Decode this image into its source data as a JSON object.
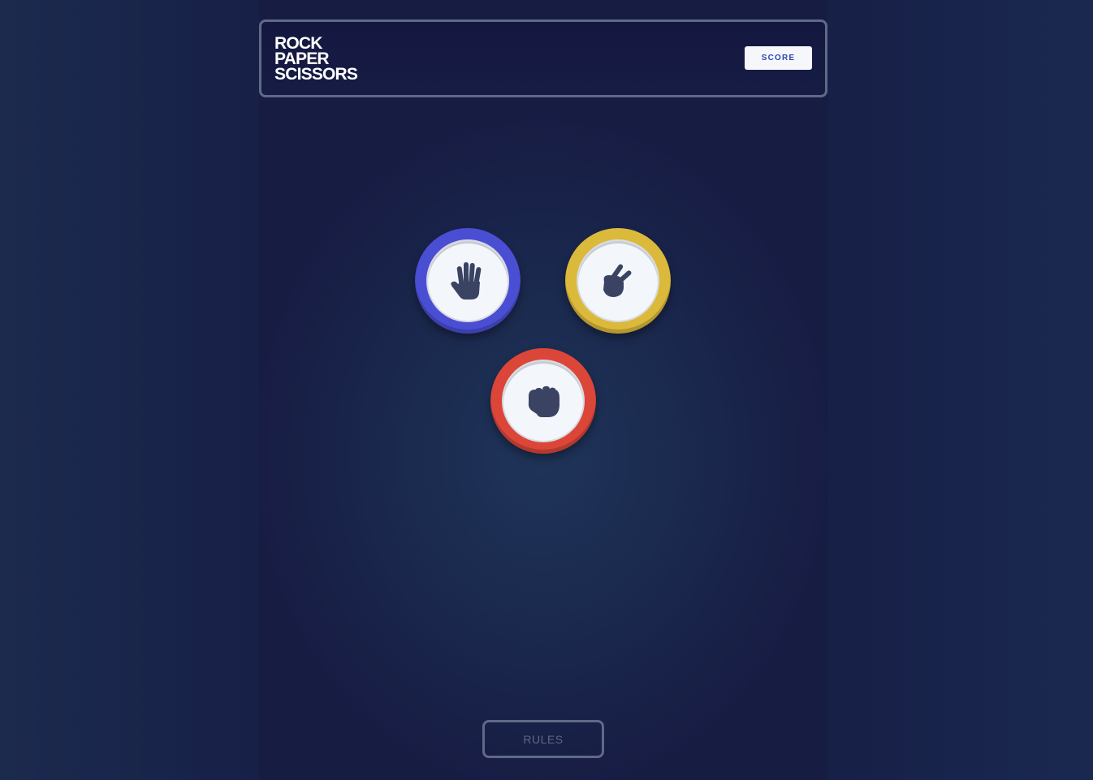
{
  "header": {
    "title_lines": [
      "ROCK",
      "PAPER",
      "SCISSORS"
    ],
    "score_label": "SCORE"
  },
  "choices": [
    {
      "name": "paper",
      "icon": "paper-hand-icon",
      "ring_color": "#4a4ed3"
    },
    {
      "name": "scissors",
      "icon": "scissors-hand-icon",
      "ring_color": "#dbb93a"
    },
    {
      "name": "rock",
      "icon": "rock-fist-icon",
      "ring_color": "#db4639"
    }
  ],
  "footer": {
    "rules_label": "RULES"
  },
  "colors": {
    "background": "#172047",
    "icon": "#3b4363",
    "border": "#5f6a86"
  }
}
